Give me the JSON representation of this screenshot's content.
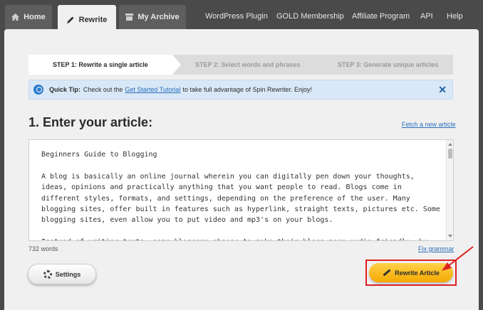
{
  "nav": {
    "tabs": [
      {
        "label": "Home",
        "icon": "home-icon"
      },
      {
        "label": "Rewrite",
        "icon": "pencil-icon"
      },
      {
        "label": "My Archive",
        "icon": "archive-icon"
      }
    ],
    "links": [
      "WordPress Plugin",
      "GOLD Membership",
      "Affiliate Program",
      "API",
      "Help"
    ]
  },
  "steps": [
    "STEP 1: Rewrite a single article",
    "STEP 2: Select words and phrases",
    "STEP 3: Generate unique articles"
  ],
  "tip": {
    "title": "Quick Tip:",
    "text_before": "Check out the",
    "link": "Get Started Tutorial",
    "text_after": "to take full advantage of Spin Rewriter. Enjoy!"
  },
  "article": {
    "heading": "1. Enter your article:",
    "fetch_link": "Fetch a new article",
    "content": "Beginners Guide to Blogging\n\nA blog is basically an online journal wherein you can digitally pen down your thoughts, ideas, opinions and practically anything that you want people to read. Blogs come in different styles, formats, and settings, depending on the preference of the user. Many blogging sites, offer built in features such as hyperlink, straight texts, pictures etc. Some blogging sites, even allow you to put video and mp3's on your blogs.\n\nInstead of writing texts, some bloggers choose to make their blogs more audio friendly, by using",
    "word_count": "732 words",
    "fix_grammar": "Fix grammar"
  },
  "buttons": {
    "settings": "Settings",
    "rewrite": "Rewrite Article"
  },
  "colors": {
    "accent": "#f5b800",
    "link": "#2a6ebb",
    "highlight": "#e02020"
  }
}
